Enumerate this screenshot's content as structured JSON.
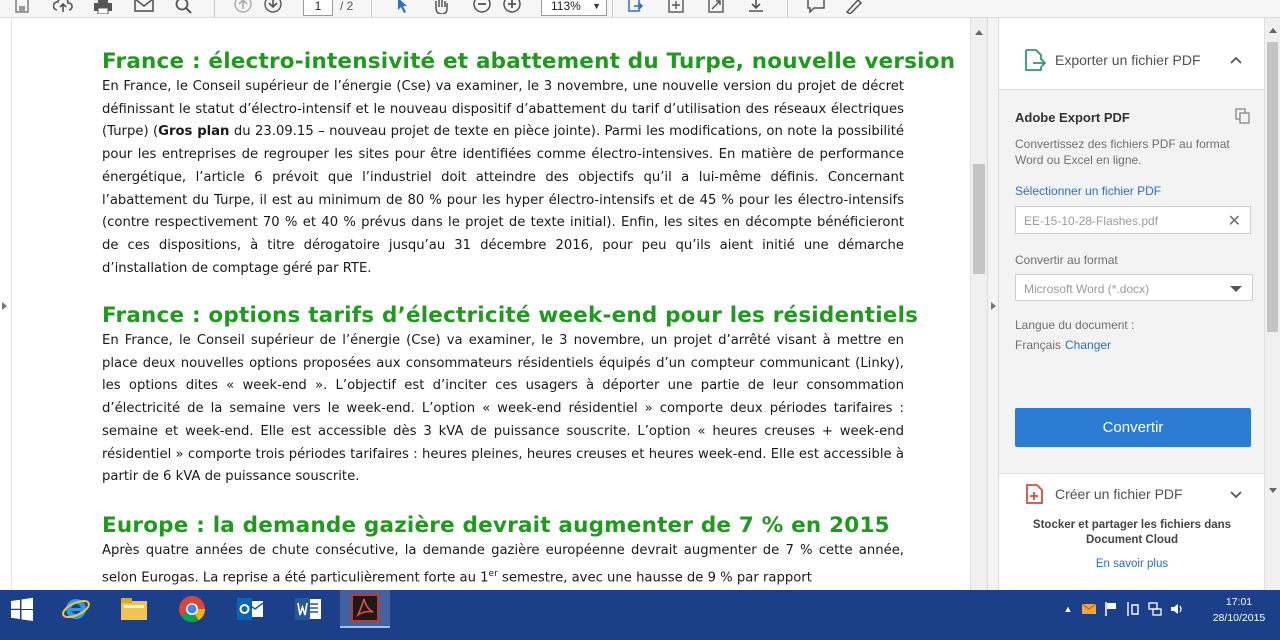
{
  "toolbar": {
    "page_current": "1",
    "page_total": "/ 2",
    "zoom": "113%"
  },
  "document": {
    "articles": [
      {
        "title": "France : électro-intensivité et abattement du Turpe, nouvelle version",
        "body_pre": "En France, le Conseil supérieur de l’énergie (Cse) va examiner, le 3 novembre, une nouvelle version du projet de décret définissant le statut d’électro-intensif et le nouveau dispositif d’abattement du tarif d’utilisation des réseaux électriques (Turpe) (",
        "body_bold": "Gros plan",
        "body_post": " du 23.09.15 – nouveau projet de texte en pièce jointe). Parmi les modifications, on note la possibilité pour les entreprises de regrouper les sites pour être identifiées comme électro-intensives. En matière de performance énergétique, l’article 6 prévoit que l’industriel doit atteindre des objectifs qu’il a lui-même définis. Concernant l’abattement du Turpe, il est au minimum de 80 % pour les hyper électro-intensifs et de 45 % pour les électro-intensifs (contre respectivement 70 % et 40 % prévus dans le projet de texte initial). Enfin, les sites en décompte bénéficieront de ces dispositions, à titre dérogatoire jusqu’au 31 décembre 2016, pour peu qu’ils aient initié une démarche d’installation de comptage géré par RTE."
      },
      {
        "title": "France : options tarifs d’électricité week-end pour les résidentiels",
        "body": "En France, le Conseil supérieur de l’énergie (Cse) va examiner, le 3 novembre, un projet d’arrêté visant à mettre en place deux nouvelles options proposées aux consommateurs résidentiels équipés d’un compteur communicant (Linky), les options dites « week-end ». L’objectif est d’inciter ces usagers à déporter une partie de leur consommation d’électricité de la semaine vers le week-end. L’option « week-end résidentiel » comporte deux périodes tarifaires : semaine et week-end. Elle est accessible dès 3 kVA de puissance souscrite. L’option « heures creuses + week-end résidentiel » comporte trois périodes tarifaires : heures pleines, heures creuses et heures week-end. Elle est accessible à partir de 6 kVA de puissance souscrite."
      },
      {
        "title": "Europe : la demande gazière devrait augmenter de 7 % en 2015",
        "body_pre": "Après quatre années de chute consécutive, la demande gazière européenne devrait augmenter de 7 % cette année, selon Eurogas. La reprise a été particulièrement forte au 1",
        "body_sup": "er",
        "body_post": " semestre, avec une hausse de 9 % par rapport"
      }
    ]
  },
  "panel": {
    "export_title": "Exporter un fichier PDF",
    "adobe_title": "Adobe Export PDF",
    "description": "Convertissez des fichiers PDF au format Word ou Excel en ligne.",
    "select_link": "Sélectionner un fichier PDF",
    "file_name": "EE-15-10-28-Flashes.pdf",
    "convert_to_label": "Convertir au format",
    "format_value": "Microsoft Word (*.docx)",
    "language_label": "Langue du document :",
    "language_value": "Français",
    "language_change": "Changer",
    "convert_button": "Convertir",
    "create_title": "Créer un fichier PDF",
    "cloud_text": "Stocker et partager les fichiers dans Document Cloud",
    "cloud_link": "En savoir plus"
  },
  "taskbar": {
    "time": "17:01",
    "date": "28/10/2015"
  },
  "colors": {
    "heading_green": "#1f9a1f",
    "link_blue": "#2a6fbf",
    "button_blue": "#2b7cd3",
    "taskbar_blue": "#1c3f8a"
  },
  "icons": [
    "save-icon",
    "upload-icon",
    "print-icon",
    "mail-icon",
    "search-icon",
    "arrow-up-icon",
    "arrow-down-icon",
    "select-cursor-icon",
    "hand-icon",
    "zoom-out-icon",
    "zoom-in-icon",
    "page-export-icon",
    "fit-page-icon",
    "fullscreen-icon",
    "scroll-mode-icon",
    "comment-icon",
    "sign-icon"
  ]
}
